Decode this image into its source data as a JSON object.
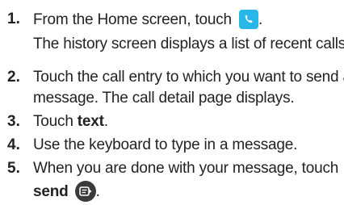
{
  "steps": [
    {
      "number": "1.",
      "line1_text": "From the Home screen, touch",
      "line1_icon": "phone-icon",
      "line1_end": ".",
      "line2_text": "The history screen displays a list of recent calls."
    },
    {
      "number": "2.",
      "line1_text": "Touch the call entry to which you want to send a",
      "line2_text": "message. The call detail page displays."
    },
    {
      "number": "3.",
      "prefix": "Touch ",
      "bold": "text",
      "suffix": "."
    },
    {
      "number": "4.",
      "text": "Use the keyboard to type in a message."
    },
    {
      "number": "5.",
      "line1_text": "When you are done with your message, touch",
      "line2_bold": "send",
      "line2_icon": "send-icon",
      "line2_end": "."
    }
  ],
  "colors": {
    "phone_icon_bg": "#29b6e8",
    "send_icon_bg": "#3a3a3a"
  }
}
